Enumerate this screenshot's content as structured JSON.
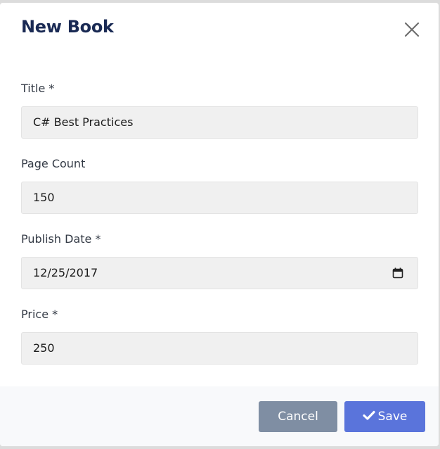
{
  "modal": {
    "title": "New Book",
    "close_icon": "close-icon"
  },
  "form": {
    "title": {
      "label": "Title *",
      "value": "C# Best Practices"
    },
    "page_count": {
      "label": "Page Count",
      "value": "150"
    },
    "publish_date": {
      "label": "Publish Date *",
      "value": "12/25/2017",
      "icon": "calendar-icon"
    },
    "price": {
      "label": "Price *",
      "value": "250"
    }
  },
  "footer": {
    "cancel_label": "Cancel",
    "save_label": "Save",
    "save_icon": "check-icon"
  },
  "colors": {
    "title": "#1a2a54",
    "cancel_button": "#7f8ea3",
    "save_button": "#5a74db",
    "input_background": "#f0f0f0"
  }
}
